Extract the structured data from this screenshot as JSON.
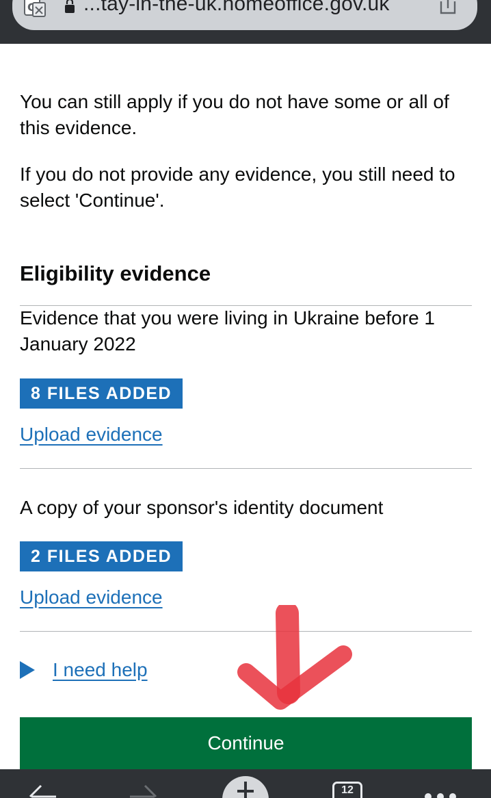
{
  "browser": {
    "url": "...tay-in-the-uk.homeoffice.gov.uk"
  },
  "intro": {
    "para1": "You can still apply if you do not have some or all of this evidence.",
    "para2": "If you do not provide any evidence, you still need to select 'Continue'."
  },
  "section": {
    "heading": "Eligibility evidence",
    "items": [
      {
        "label": "Evidence that you were living in Ukraine before 1 January 2022",
        "tag": "8 FILES ADDED",
        "link": "Upload evidence"
      },
      {
        "label": "A copy of your sponsor's identity document",
        "tag": "2 FILES ADDED",
        "link": "Upload evidence"
      }
    ]
  },
  "help": {
    "label": "I need help"
  },
  "actions": {
    "continue_label": "Continue"
  },
  "bottom_bar": {
    "tabs_count": "12"
  },
  "colors": {
    "link": "#1d70b8",
    "tag_bg": "#1d70b8",
    "button_bg": "#00703c",
    "chrome": "#2f3236",
    "annotation": "#e8333d"
  },
  "icons": [
    "translate-icon",
    "lock-icon",
    "share-icon",
    "back-icon",
    "forward-icon",
    "new-tab-icon",
    "tabs-icon",
    "more-icon",
    "expand-triangle-icon",
    "annotation-arrow-icon"
  ]
}
